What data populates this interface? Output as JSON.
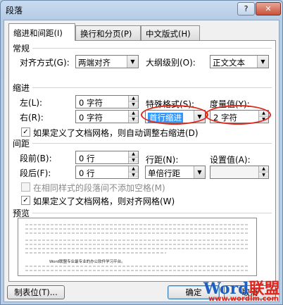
{
  "title": "段落",
  "title_buttons": {
    "help": "?",
    "close": "✕"
  },
  "tabs": [
    "缩进和间距(I)",
    "换行和分页(P)",
    "中文版式(H)"
  ],
  "general": {
    "header": "常规",
    "align_label": "对齐方式(G):",
    "align_value": "两端对齐",
    "outline_label": "大纲级别(O):",
    "outline_value": "正文文本"
  },
  "indent": {
    "header": "缩进",
    "left_label": "左(L):",
    "left_value": "0 字符",
    "right_label": "右(R):",
    "right_value": "0 字符",
    "special_label": "特殊格式(S):",
    "special_value": "首行缩进",
    "by_label": "度量值(Y):",
    "by_value": "2 字符",
    "auto_adjust_label": "如果定义了文档网格，则自动调整右缩进(D)",
    "auto_adjust_checked": true
  },
  "spacing": {
    "header": "间距",
    "before_label": "段前(B):",
    "before_value": "0 行",
    "after_label": "段后(F):",
    "after_value": "0 行",
    "line_label": "行距(N):",
    "line_value": "单倍行距",
    "at_label": "设置值(A):",
    "at_value": "",
    "no_space_label": "在相同样式的段落间不添加空格(M)",
    "no_space_checked": false,
    "snap_grid_label": "如果定义了文档网格，则对齐网格(W)",
    "snap_grid_checked": true
  },
  "preview": {
    "header": "预览",
    "sample_text": "Word联盟专业最专业的办公软件学习平台。"
  },
  "buttons": {
    "tabs": "制表位(T)...",
    "ok": "确定",
    "cancel": "取消"
  },
  "watermark": {
    "part1": "Word",
    "part2": "联盟",
    "url": "www.wordlm.com"
  },
  "colors": {
    "highlight": "#3399ff",
    "annotation": "#e0281b"
  }
}
